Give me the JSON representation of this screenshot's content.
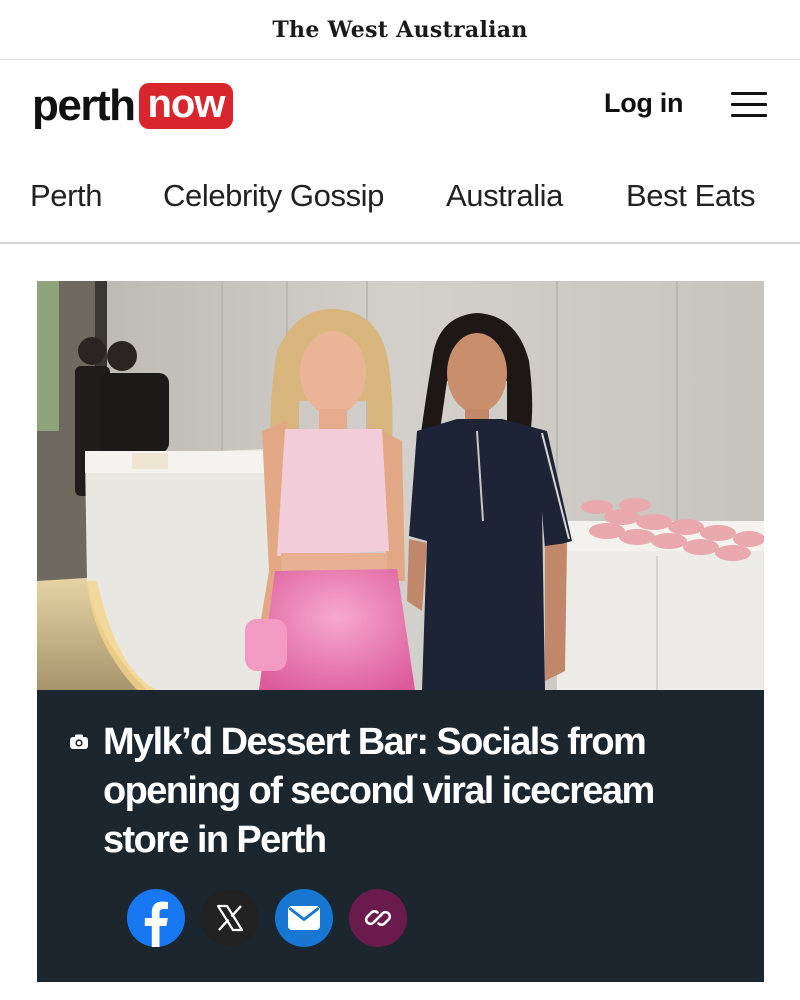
{
  "masthead": {
    "title": "The West Australian"
  },
  "header": {
    "logo": {
      "part1": "perth",
      "part2": "now"
    },
    "login_label": "Log in",
    "menu_icon": "hamburger-menu-icon"
  },
  "nav": {
    "items": [
      {
        "label": "Perth"
      },
      {
        "label": "Celebrity Gossip"
      },
      {
        "label": "Australia"
      },
      {
        "label": "Best Eats"
      }
    ]
  },
  "article": {
    "gallery_icon": "camera-icon",
    "headline": "Mylk’d Dessert Bar: Socials from opening of second viral icecream store in Perth",
    "share": [
      {
        "icon": "facebook-icon",
        "color": "#1877f2"
      },
      {
        "icon": "x-icon",
        "color": "#222222"
      },
      {
        "icon": "email-icon",
        "color": "#1877d2"
      },
      {
        "icon": "link-icon",
        "color": "#6b1a4d"
      }
    ]
  },
  "colors": {
    "brand_red": "#d9262c",
    "panel_bg": "#1b262e"
  }
}
